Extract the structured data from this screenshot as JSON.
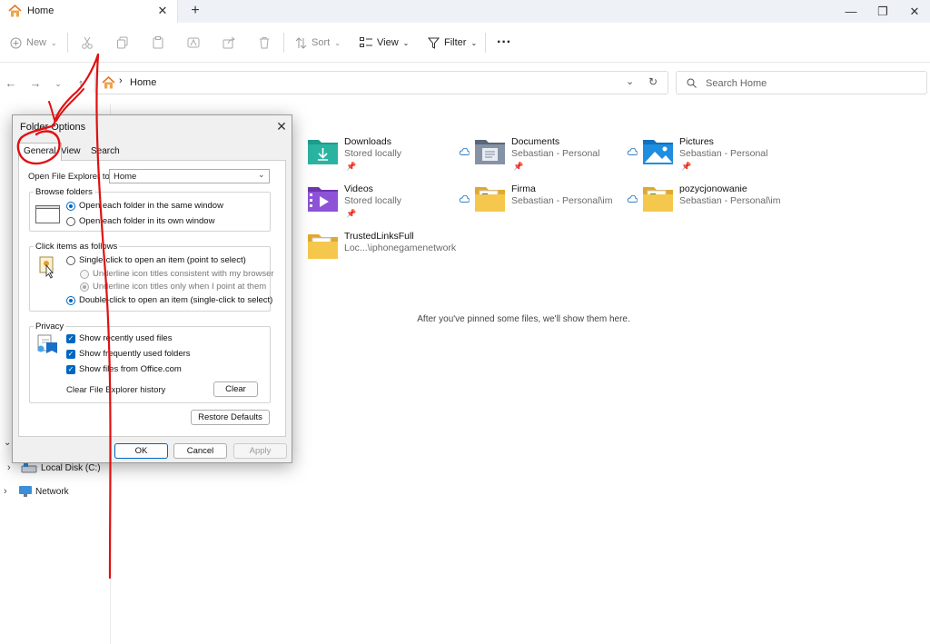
{
  "window": {
    "tab_title": "Home",
    "new_tab_glyph": "+",
    "controls": [
      "minimize",
      "restore",
      "close"
    ]
  },
  "toolbar": {
    "new_label": "New",
    "sort_label": "Sort",
    "view_label": "View",
    "filter_label": "Filter",
    "more_glyph": "···"
  },
  "address": {
    "path": "Home",
    "search_placeholder": "Search Home"
  },
  "sidebar": {
    "items": [
      {
        "label": "Local Disk (C:)"
      },
      {
        "label": "Network"
      }
    ]
  },
  "quick_access": {
    "items": [
      {
        "name": "Downloads",
        "sub": "Stored locally",
        "pinned": true,
        "icon": "downloads-folder-icon",
        "color": "#2aa89a"
      },
      {
        "name": "Documents",
        "sub": "Sebastian - Personal",
        "pinned": true,
        "cloud": true,
        "icon": "documents-folder-icon",
        "color": "#7a8699"
      },
      {
        "name": "Pictures",
        "sub": "Sebastian - Personal",
        "pinned": true,
        "cloud": true,
        "icon": "pictures-folder-icon",
        "color": "#1a8ad6"
      },
      {
        "name": "Videos",
        "sub": "Stored locally",
        "pinned": true,
        "icon": "videos-folder-icon",
        "color": "#8a4cc9"
      },
      {
        "name": "Firma",
        "sub": "Sebastian - Personal\\im",
        "cloud": true,
        "icon": "folder-icon",
        "color": "#f2c24b"
      },
      {
        "name": "pozycjonowanie",
        "sub": "Sebastian - Personal\\im",
        "cloud": true,
        "icon": "folder-icon",
        "color": "#f2c24b"
      },
      {
        "name": "TrustedLinksFull",
        "sub": "Loc...\\iphonegamenetwork",
        "icon": "folder-icon",
        "color": "#f2c24b"
      }
    ],
    "empty_message": "After you've pinned some files, we'll show them here."
  },
  "dialog": {
    "title": "Folder Options",
    "tabs": [
      "General",
      "View",
      "Search"
    ],
    "open_to_label": "Open File Explorer to:",
    "open_to_value": "Home",
    "browse": {
      "title": "Browse folders",
      "opt_same": "Open each folder in the same window",
      "opt_own": "Open each folder in its own window"
    },
    "click": {
      "title": "Click items as follows",
      "opt_single": "Single-click to open an item (point to select)",
      "opt_underline_browser": "Underline icon titles consistent with my browser",
      "opt_underline_point": "Underline icon titles only when I point at them",
      "opt_double": "Double-click to open an item (single-click to select)"
    },
    "privacy": {
      "title": "Privacy",
      "chk_recent_files": "Show recently used files",
      "chk_frequent_folders": "Show frequently used folders",
      "chk_office": "Show files from Office.com",
      "clear_history_label": "Clear File Explorer history",
      "clear_button": "Clear"
    },
    "restore_button": "Restore Defaults",
    "ok_button": "OK",
    "cancel_button": "Cancel",
    "apply_button": "Apply"
  },
  "colors": {
    "accent": "#0067c0",
    "annotation": "#e01010"
  }
}
